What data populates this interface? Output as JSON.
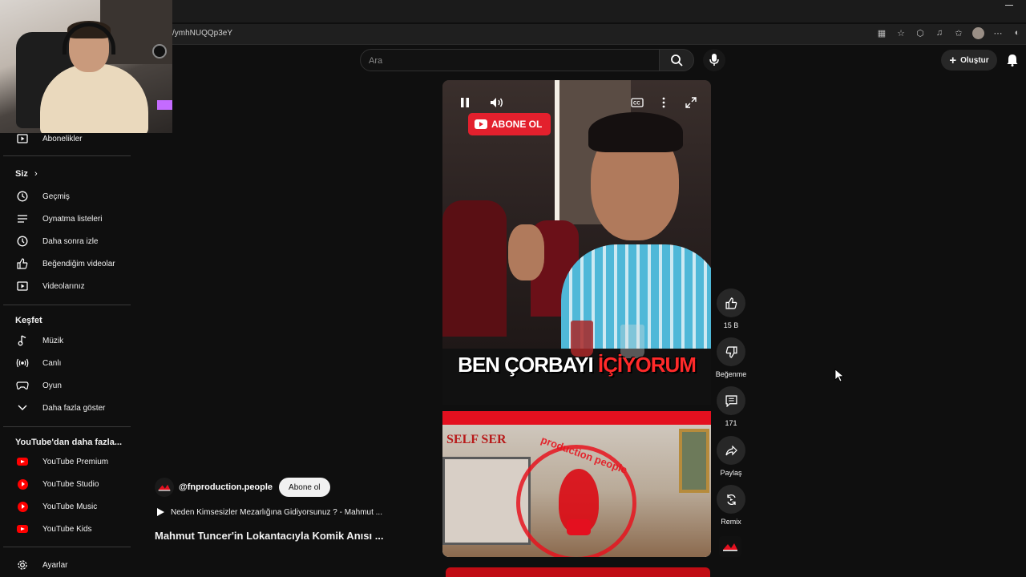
{
  "browser": {
    "url": "/ymhNUQQp3eY"
  },
  "header": {
    "search_placeholder": "Ara",
    "create_label": "Oluştur"
  },
  "sidebar": {
    "subscriptions_label": "Abonelikler",
    "you_heading": "Siz",
    "you_items": [
      {
        "label": "Geçmiş",
        "icon": "history-icon"
      },
      {
        "label": "Oynatma listeleri",
        "icon": "playlist-icon"
      },
      {
        "label": "Daha sonra izle",
        "icon": "clock-icon"
      },
      {
        "label": "Beğendiğim videolar",
        "icon": "thumbs-up-icon"
      },
      {
        "label": "Videolarınız",
        "icon": "your-videos-icon"
      }
    ],
    "explore_heading": "Keşfet",
    "explore_items": [
      {
        "label": "Müzik",
        "icon": "music-note-icon"
      },
      {
        "label": "Canlı",
        "icon": "live-icon"
      },
      {
        "label": "Oyun",
        "icon": "gaming-icon"
      },
      {
        "label": "Daha fazla göster",
        "icon": "chevron-down-icon"
      }
    ],
    "more_heading": "YouTube'dan daha fazla...",
    "more_items": [
      {
        "label": "YouTube Premium"
      },
      {
        "label": "YouTube Studio"
      },
      {
        "label": "YouTube Music"
      },
      {
        "label": "YouTube Kids"
      }
    ],
    "settings_label": "Ayarlar"
  },
  "player": {
    "subscribe_badge": "ABONE OL",
    "caption_white": "BEN ÇORBAYI ",
    "caption_red": "İÇİYORUM",
    "thumb_sign": "SELF SER",
    "thumb_stamp": "production people"
  },
  "actions": {
    "like_count": "15 B",
    "dislike_label": "Beğenme",
    "comment_count": "171",
    "share_label": "Paylaş",
    "remix_label": "Remix"
  },
  "video": {
    "channel_handle": "@fnproduction.people",
    "subscribe_label": "Abone ol",
    "playlist_text": "Neden Kimsesizler Mezarlığına Gidiyorsunuz ? - Mahmut ...",
    "title": "Mahmut Tuncer'in Lokantacıyla Komik Anısı ..."
  },
  "colors": {
    "background": "#0f0f0f",
    "brand_red": "#ff0000",
    "subscribe_badge": "#e3202d"
  }
}
